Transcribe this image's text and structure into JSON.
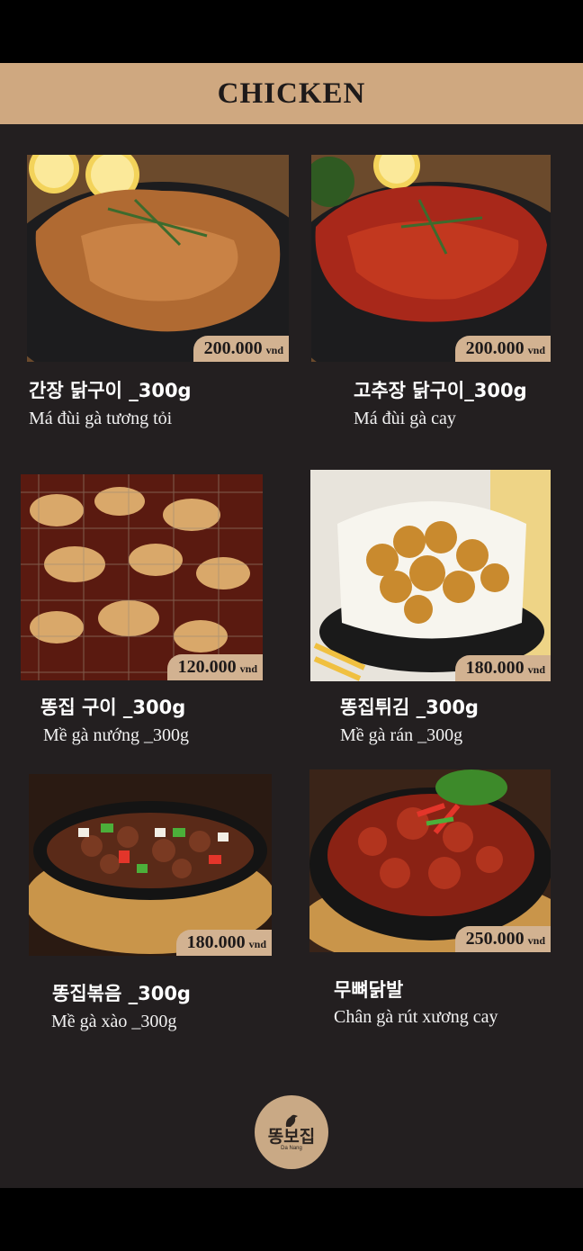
{
  "header": {
    "title": "CHICKEN"
  },
  "items": [
    {
      "ko": "간장 닭구이 _300g",
      "vi": "Má đùi gà tương tỏi",
      "price": "200.000",
      "currency": "vnd",
      "photo": "grilled-soy-chicken-photo"
    },
    {
      "ko": "고추장 닭구이_300g",
      "vi": "Má đùi gà cay",
      "price": "200.000",
      "currency": "vnd",
      "photo": "spicy-grilled-chicken-photo"
    },
    {
      "ko": "똥집 구이 _300g",
      "vi": "Mề gà nướng _300g",
      "price": "120.000",
      "currency": "vnd",
      "photo": "grilled-gizzard-photo"
    },
    {
      "ko": "똥집튀김 _300g",
      "vi": "Mề gà rán _300g",
      "price": "180.000",
      "currency": "vnd",
      "photo": "fried-gizzard-photo"
    },
    {
      "ko": "똥집볶음 _300g",
      "vi": "Mề gà xào _300g",
      "price": "180.000",
      "currency": "vnd",
      "photo": "stirfried-gizzard-photo"
    },
    {
      "ko": "무뼈닭발",
      "vi": "Chân gà rút xương cay",
      "price": "250.000",
      "currency": "vnd",
      "photo": "boneless-chicken-feet-photo"
    }
  ],
  "logo": {
    "mark": "똥보집",
    "sub": "Da Nang"
  },
  "colors": {
    "background": "#231f20",
    "header": "#cfa880",
    "price_tag": "#d2b291"
  }
}
